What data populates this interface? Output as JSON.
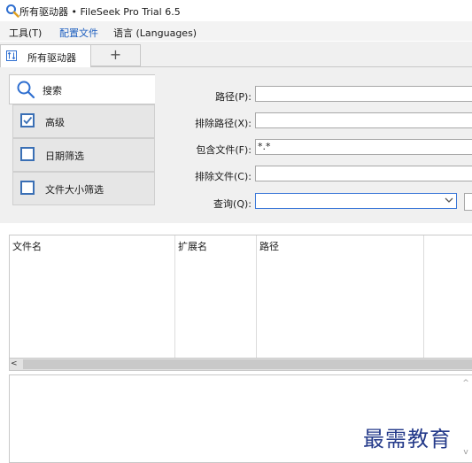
{
  "window": {
    "title": "所有驱动器 • FileSeek Pro Trial 6.5"
  },
  "menu": {
    "items": [
      {
        "label": "工具(T)",
        "active": false
      },
      {
        "label": "配置文件",
        "active": true
      },
      {
        "label": "语言 (Languages)",
        "active": false
      }
    ]
  },
  "tabs": {
    "current": "所有驱动器",
    "add_symbol": "+"
  },
  "left_panel": {
    "search_label": "搜索",
    "options": [
      {
        "label": "高级",
        "checked": true
      },
      {
        "label": "日期筛选",
        "checked": false
      },
      {
        "label": "文件大小筛选",
        "checked": false
      }
    ]
  },
  "form": {
    "path_label": "路径(P):",
    "path_value": "",
    "exclude_path_label": "排除路径(X):",
    "exclude_path_value": "",
    "include_files_label": "包含文件(F):",
    "include_files_value": "*.*",
    "exclude_files_label": "排除文件(C):",
    "exclude_files_value": "",
    "query_label": "查询(Q):",
    "query_value": ""
  },
  "results": {
    "columns": [
      "文件名",
      "扩展名",
      "路径"
    ]
  },
  "scrollbar": {
    "left_arrow": "<"
  },
  "details": {
    "up_arrow": "^",
    "down_arrow": "v"
  },
  "watermark": "最需教育",
  "colors": {
    "accent": "#1e5fbf",
    "checkbox": "#3a6fb5",
    "watermark": "#243a8a"
  }
}
